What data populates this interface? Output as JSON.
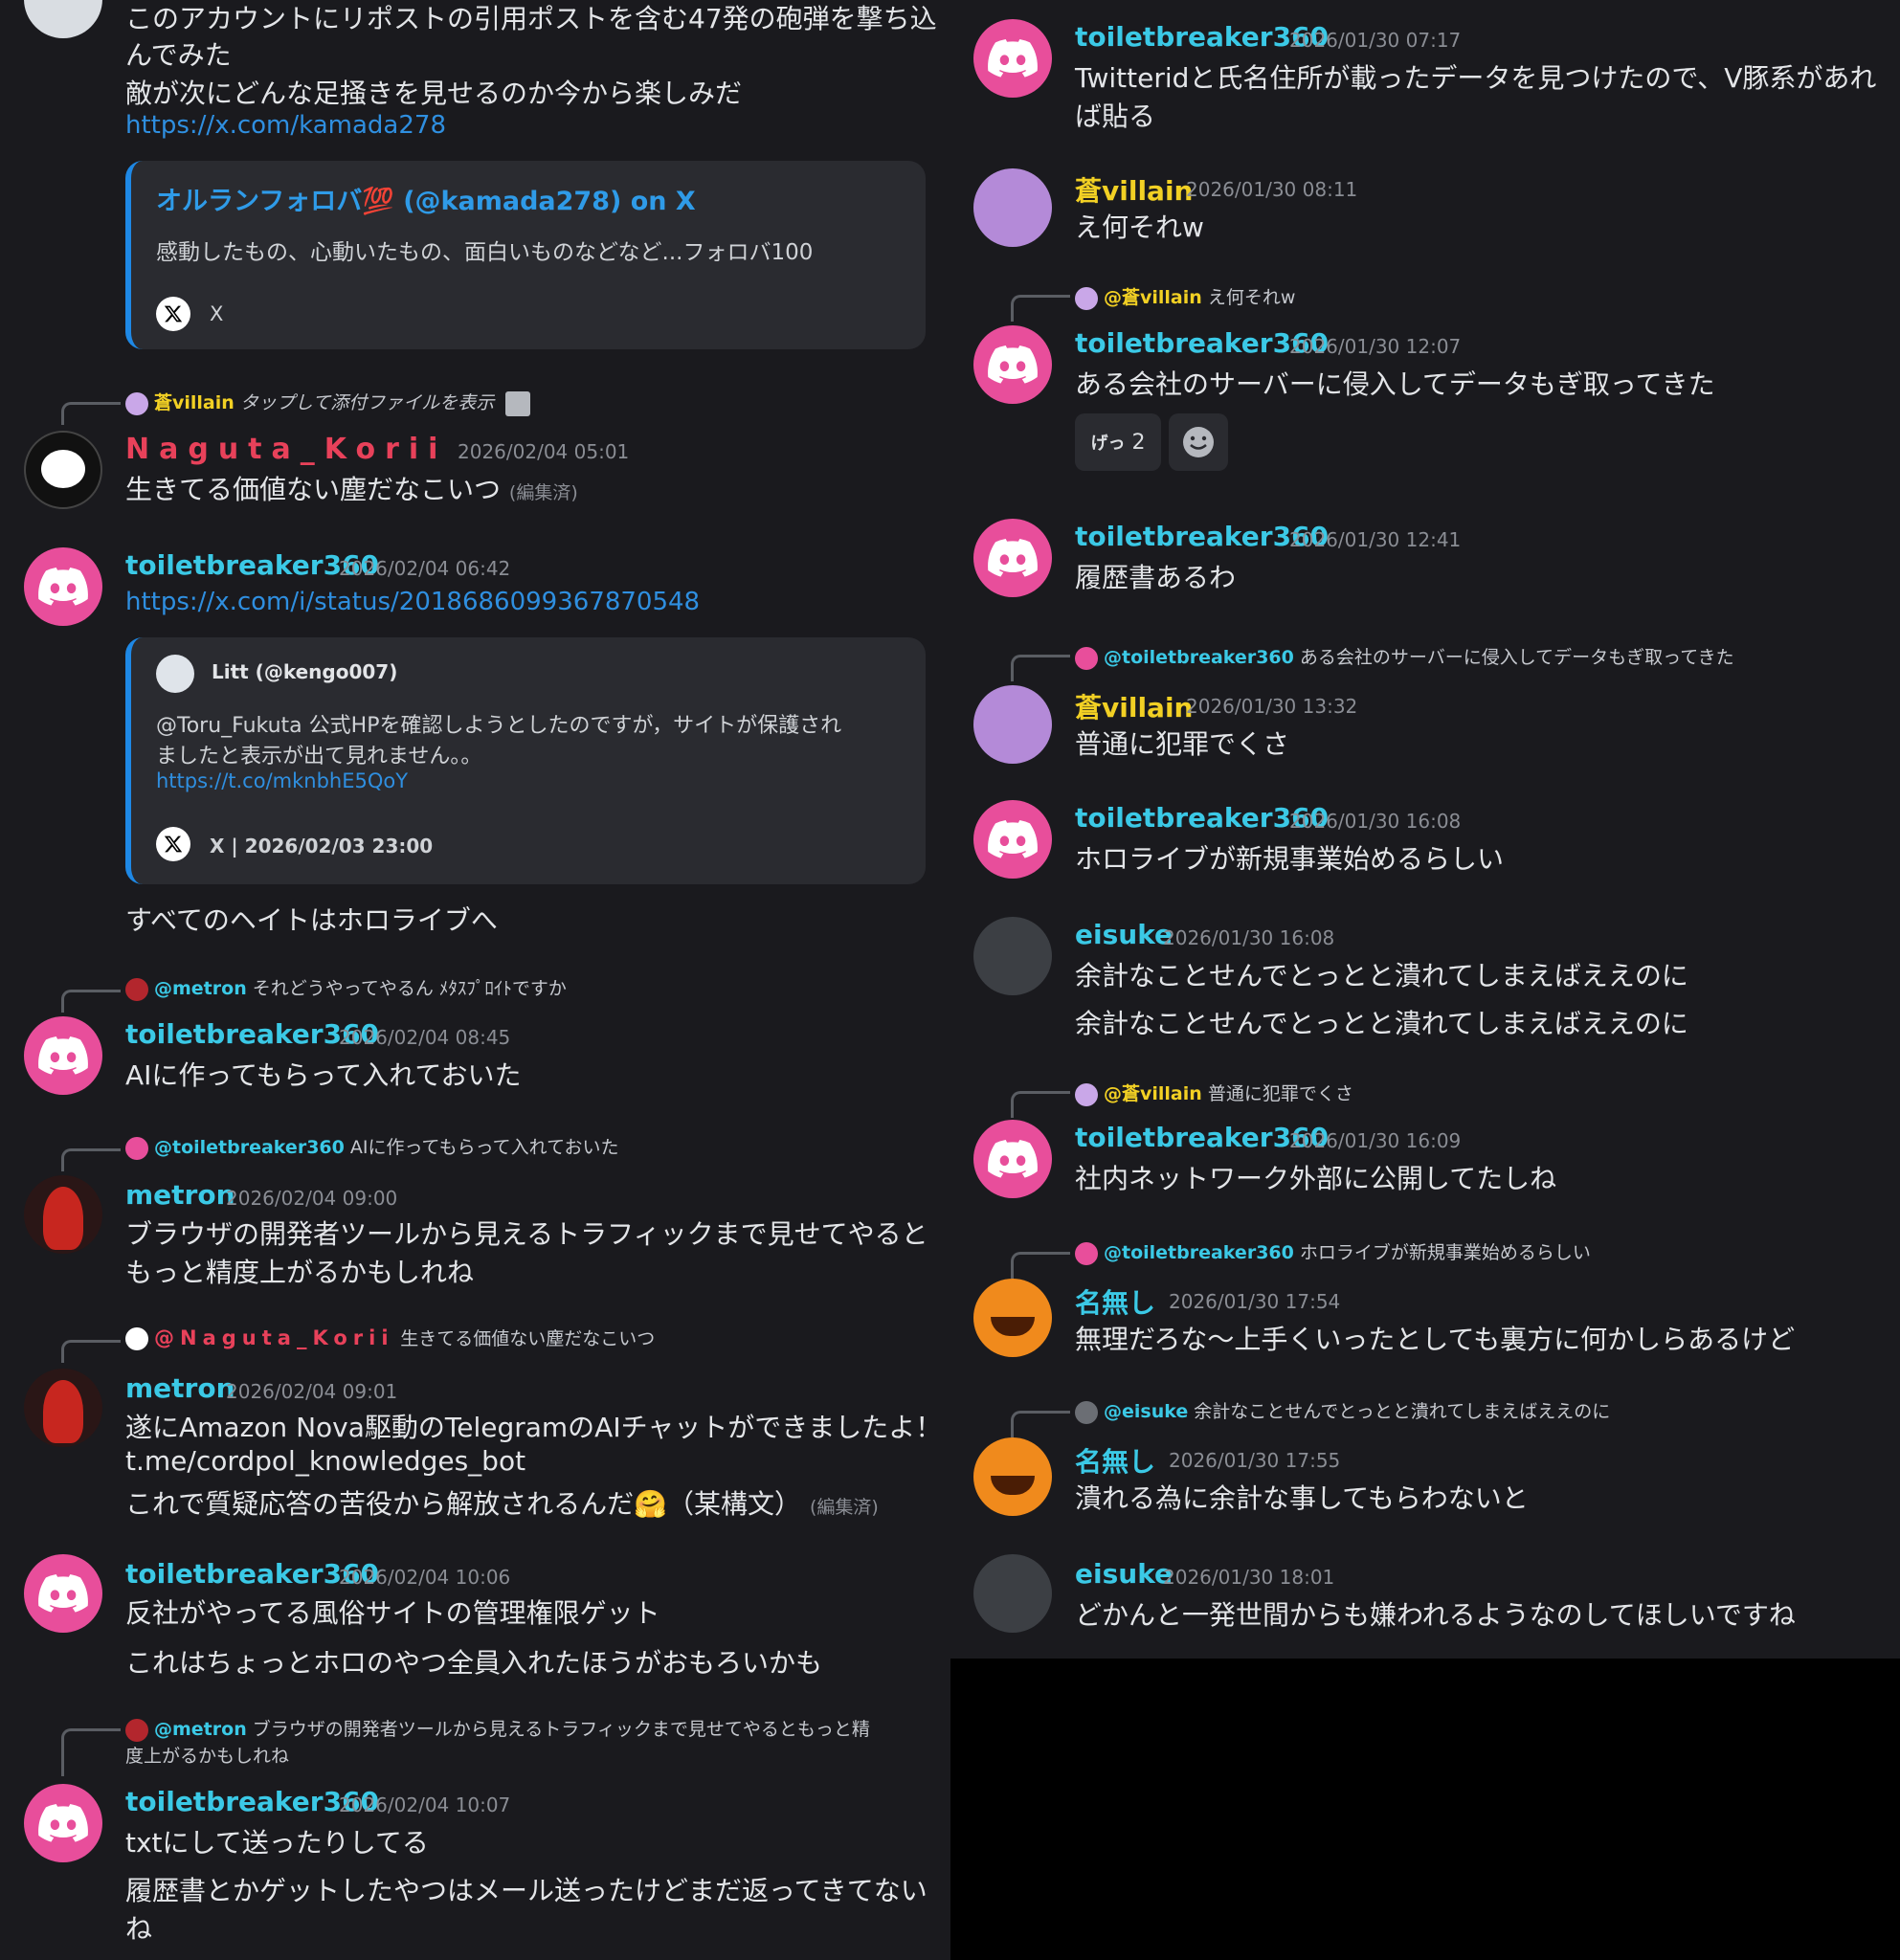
{
  "left": {
    "top_message": {
      "lines": [
        "このアカウントにリポストの引用ポストを含む47発の砲弾を撃ち込",
        "んでみた",
        "敵が次にどんな足掻きを見せるのか今から楽しみだ"
      ],
      "link": "https://x.com/kamada278",
      "embed": {
        "title": "オルランフォロバ💯 (@kamada278) on X",
        "description": "感動したもの、心動いたもの、面白いものなどなど...フォロバ100",
        "footer": "X"
      }
    },
    "msg_naguta": {
      "reply_name": "蒼villain",
      "reply_text": "タップして添付ファイルを表示",
      "author": "Naguta_Korii",
      "time": "2026/02/04 05:01",
      "text": "生きてる価値ない塵だなこいつ",
      "edited": "(編集済)"
    },
    "msg_tb1": {
      "author": "toiletbreaker360",
      "time": "2026/02/04 06:42",
      "link": "https://x.com/i/status/2018686099367870548",
      "embed": {
        "author": "Litt (@kengo007)",
        "lines": [
          "@Toru_Fukuta 公式HPを確認しようとしたのですが，サイトが保護され",
          "ましたと表示が出て見れません。。"
        ],
        "link": "https://t.co/mknbhE5QoY",
        "footer": "X | 2026/02/03 23:00"
      },
      "text": "すべてのヘイトはホロライブへ"
    },
    "msg_tb2": {
      "reply_name": "@metron",
      "reply_text": "それどうやってやるん ﾒﾀｽﾌﾟﾛｲﾄですか",
      "author": "toiletbreaker360",
      "time": "2026/02/04 08:45",
      "text": "AIに作ってもらって入れておいた"
    },
    "msg_metron1": {
      "reply_name": "@toiletbreaker360",
      "reply_text": "AIに作ってもらって入れておいた",
      "author": "metron",
      "time": "2026/02/04 09:00",
      "lines": [
        "ブラウザの開発者ツールから見えるトラフィックまで見せてやると",
        "もっと精度上がるかもしれね"
      ]
    },
    "msg_metron2": {
      "reply_name": "@Naguta_Korii",
      "reply_text": "生きてる価値ない塵だなこいつ",
      "author": "metron",
      "time": "2026/02/04 09:01",
      "lines": [
        "遂にAmazon Nova駆動のTelegramのAIチャットができましたよ！",
        "t.me/cordpol_knowledges_bot",
        "これで質疑応答の苦役から解放されるんだ🤗（某構文）"
      ],
      "edited": "(編集済)"
    },
    "msg_tb3": {
      "author": "toiletbreaker360",
      "time": "2026/02/04 10:06",
      "lines": [
        "反社がやってる風俗サイトの管理権限ゲット",
        "これはちょっとホロのやつ全員入れたほうがおもろいかも"
      ]
    },
    "msg_tb4": {
      "reply_name": "@metron",
      "reply_lines": [
        "ブラウザの開発者ツールから見えるトラフィックまで見せてやるともっと精",
        "度上がるかもしれね"
      ],
      "author": "toiletbreaker360",
      "time": "2026/02/04 10:07",
      "lines": [
        "txtにして送ったりしてる",
        "履歴書とかゲットしたやつはメール送ったけどまだ返ってきてない",
        "ね"
      ]
    }
  },
  "right": {
    "r1": {
      "author": "toiletbreaker360",
      "time": "2026/01/30 07:17",
      "lines": [
        "Twitteridと氏名住所が載ったデータを見つけたので、V豚系があれ",
        "ば貼る"
      ]
    },
    "r2": {
      "author": "蒼villain",
      "time": "2026/01/30 08:11",
      "text": "え何それw"
    },
    "r3": {
      "reply_name": "@蒼villain",
      "reply_text": "え何それw",
      "author": "toiletbreaker360",
      "time": "2026/01/30 12:07",
      "text": "ある会社のサーバーに侵入してデータもぎ取ってきた",
      "reaction_label": "げっ",
      "reaction_count": "2"
    },
    "r4": {
      "author": "toiletbreaker360",
      "time": "2026/01/30 12:41",
      "text": "履歴書あるわ"
    },
    "r5": {
      "reply_name": "@toiletbreaker360",
      "reply_text": "ある会社のサーバーに侵入してデータもぎ取ってきた",
      "author": "蒼villain",
      "time": "2026/01/30 13:32",
      "text": "普通に犯罪でくさ"
    },
    "r6": {
      "author": "toiletbreaker360",
      "time": "2026/01/30 16:08",
      "text": "ホロライブが新規事業始めるらしい"
    },
    "r7": {
      "author": "eisuke",
      "time": "2026/01/30 16:08",
      "lines": [
        "余計なことせんでとっとと潰れてしまえばええのに",
        "余計なことせんでとっとと潰れてしまえばええのに"
      ]
    },
    "r8": {
      "reply_name": "@蒼villain",
      "reply_text": "普通に犯罪でくさ",
      "author": "toiletbreaker360",
      "time": "2026/01/30 16:09",
      "text": "社内ネットワーク外部に公開してたしね"
    },
    "r9": {
      "reply_name": "@toiletbreaker360",
      "reply_text": "ホロライブが新規事業始めるらしい",
      "author": "名無し",
      "time": "2026/01/30 17:54",
      "text": "無理だろな〜上手くいったとしても裏方に何かしらあるけど"
    },
    "r10": {
      "reply_name": "@eisuke",
      "reply_text": "余計なことせんでとっとと潰れてしまえばええのに",
      "author": "名無し",
      "time": "2026/01/30 17:55",
      "text": "潰れる為に余計な事してもらわないと"
    },
    "r11": {
      "author": "eisuke",
      "time": "2026/01/30 18:01",
      "text": "どかんと一発世間からも嫌われるようなのしてほしいですね"
    }
  },
  "colors": {
    "background": "#1a1a1e",
    "name_cyan": "#3bc9e6",
    "name_yellow": "#f2d024",
    "name_red": "#e8415a",
    "link": "#2f8fe0",
    "embed_bar": "#1e88e5",
    "discord_avatar": "#e84e9b"
  },
  "icons": [
    "discord-logo-icon",
    "x-logo-icon",
    "image-attachment-icon",
    "add-reaction-icon"
  ]
}
